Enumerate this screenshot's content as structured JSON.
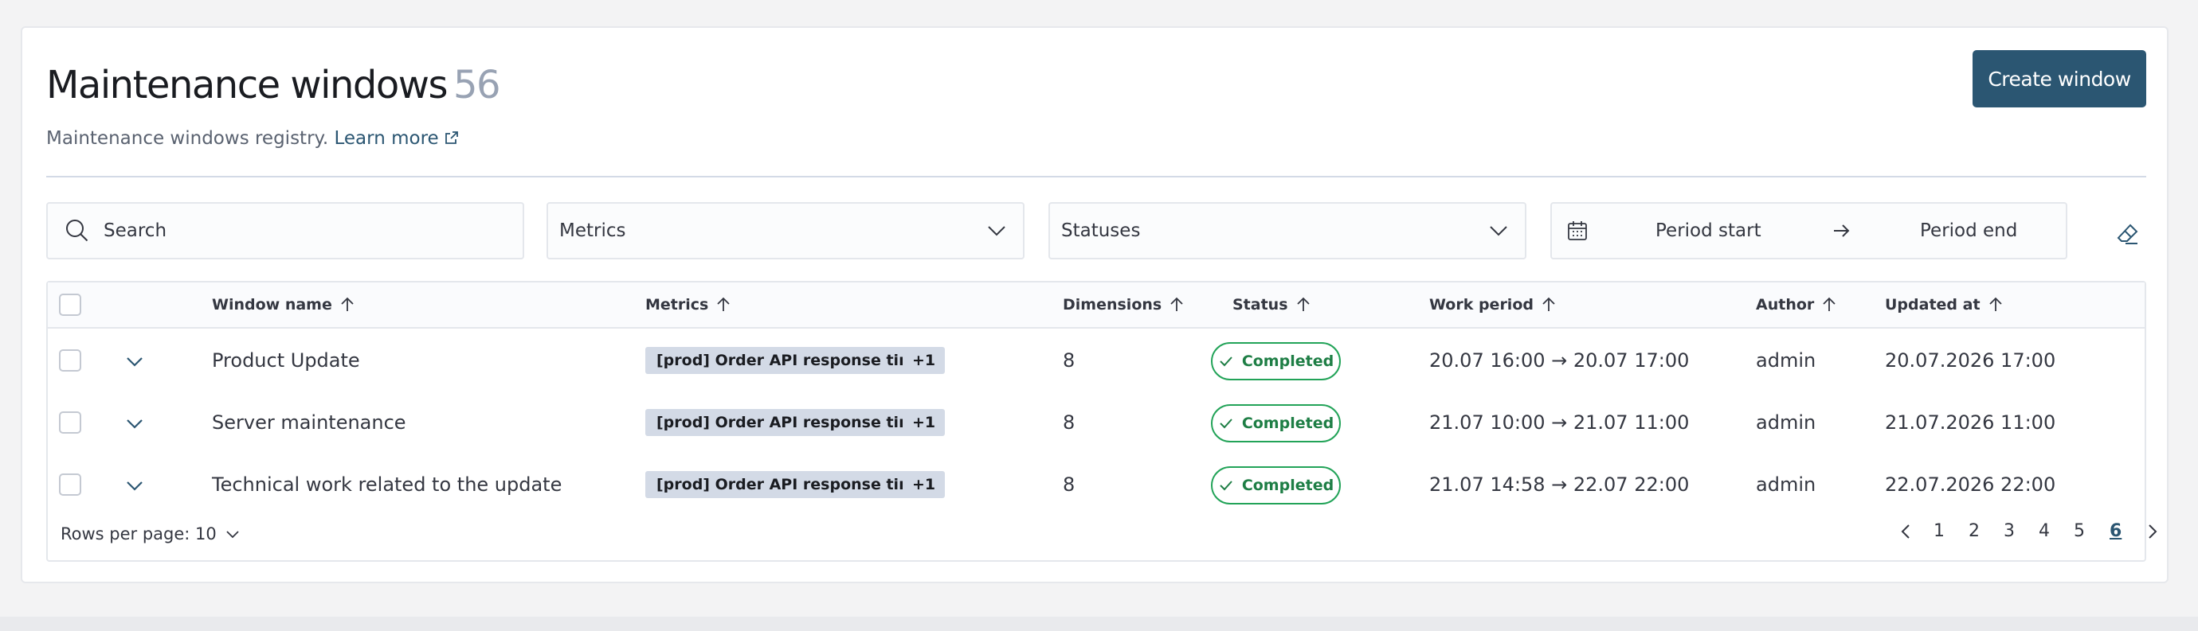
{
  "header": {
    "title": "Maintenance windows",
    "count": "56",
    "subtitle": "Maintenance windows registry.",
    "learn_more": "Learn more",
    "create_button": "Create window"
  },
  "filters": {
    "search_placeholder": "Search",
    "metrics_label": "Metrics",
    "statuses_label": "Statuses",
    "period_start": "Period start",
    "period_end": "Period end"
  },
  "table": {
    "columns": {
      "name": "Window name",
      "metrics": "Metrics",
      "dimensions": "Dimensions",
      "status": "Status",
      "work_period": "Work period",
      "author": "Author",
      "updated_at": "Updated at"
    },
    "rows": [
      {
        "name": "Product Update",
        "metric": "[prod] Order API response time",
        "metric_more": "+1",
        "dimensions": "8",
        "status": "Completed",
        "work_period": "20.07 16:00 → 20.07 17:00",
        "author": "admin",
        "updated_at": "20.07.2026 17:00"
      },
      {
        "name": "Server maintenance",
        "metric": "[prod] Order API response time",
        "metric_more": "+1",
        "dimensions": "8",
        "status": "Completed",
        "work_period": "21.07 10:00 → 21.07 11:00",
        "author": "admin",
        "updated_at": "21.07.2026 11:00"
      },
      {
        "name": "Technical work related to the update",
        "metric": "[prod] Order API response time",
        "metric_more": "+1",
        "dimensions": "8",
        "status": "Completed",
        "work_period": "21.07 14:58 → 22.07 22:00",
        "author": "admin",
        "updated_at": "22.07.2026 22:00"
      }
    ]
  },
  "pagination": {
    "rows_per_page": "Rows per page: 10",
    "pages": [
      "1",
      "2",
      "3",
      "4",
      "5",
      "6"
    ],
    "current_page": "6"
  },
  "icons": {
    "search": "search-icon",
    "chevron": "chevron-down-icon",
    "calendar": "calendar-icon",
    "eraser": "eraser-icon",
    "external_link": "external-link-icon",
    "sort": "arrow-up-icon",
    "check": "check-icon"
  },
  "colors": {
    "primary": "#2b5672",
    "success": "#22a358",
    "tag_bg": "#d3dae6"
  }
}
